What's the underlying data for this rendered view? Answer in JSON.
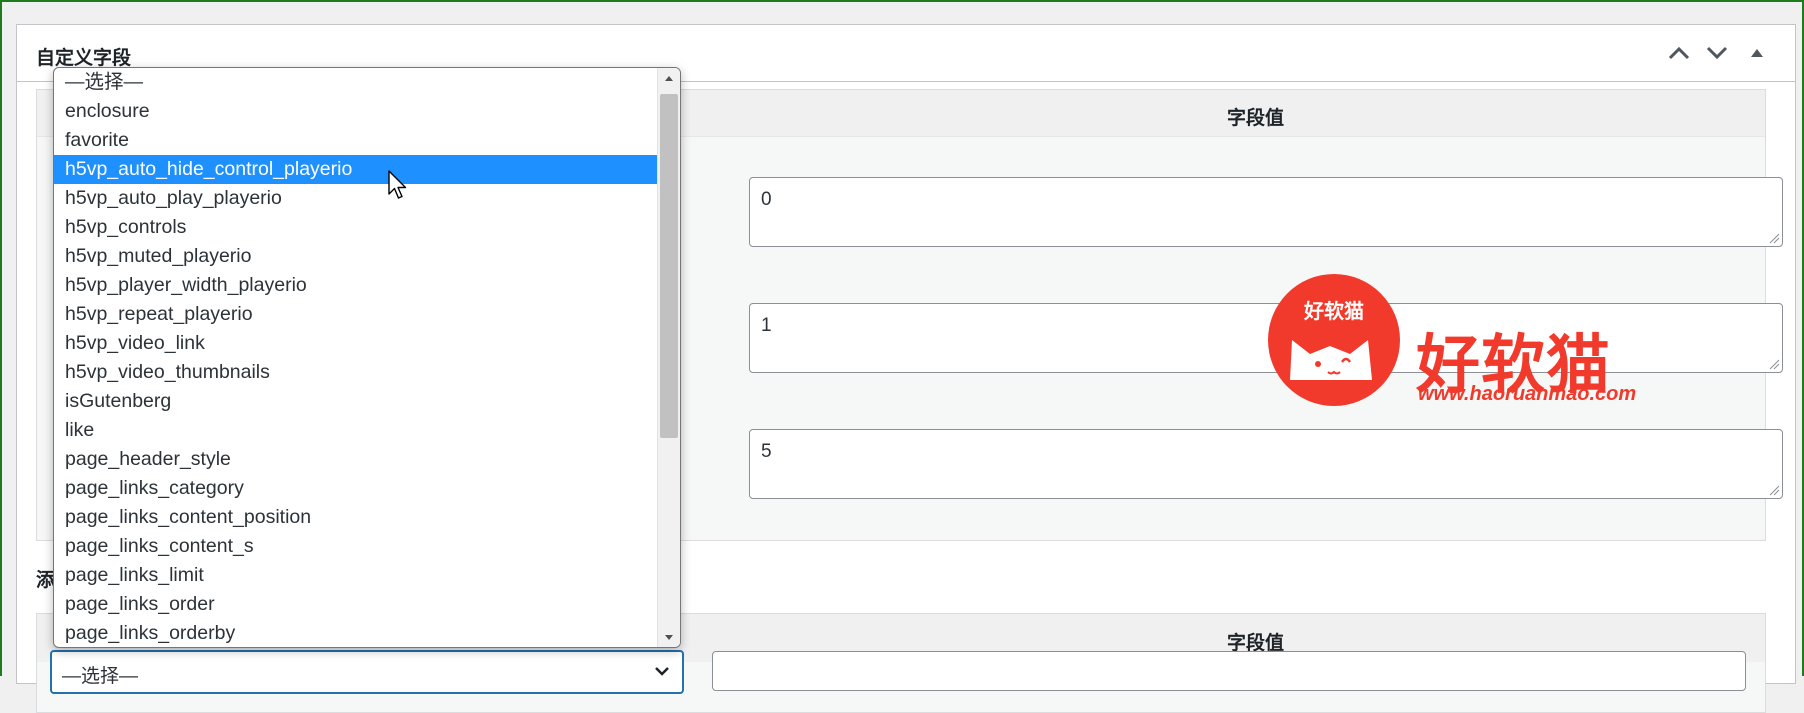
{
  "metabox": {
    "title": "自定义字段",
    "header_icons": [
      "chevron-up-icon",
      "chevron-down-icon",
      "triangle-up-icon"
    ]
  },
  "existing_fields": {
    "value_header": "字段值",
    "values": [
      "0",
      "1",
      "5"
    ]
  },
  "add_new": {
    "title_visible": "添",
    "value_header": "字段值",
    "select_value": "—选择—"
  },
  "dropdown": {
    "options": [
      "—选择—",
      "enclosure",
      "favorite",
      "h5vp_auto_hide_control_playerio",
      "h5vp_auto_play_playerio",
      "h5vp_controls",
      "h5vp_muted_playerio",
      "h5vp_player_width_playerio",
      "h5vp_repeat_playerio",
      "h5vp_video_link",
      "h5vp_video_thumbnails",
      "isGutenberg",
      "like",
      "page_header_style",
      "page_links_category",
      "page_links_content_position",
      "page_links_content_s",
      "page_links_limit",
      "page_links_order",
      "page_links_orderby"
    ],
    "selected_index": 3,
    "selected_value": "h5vp_auto_hide_control_playerio"
  },
  "watermark": {
    "logo_text": "好软猫",
    "brand_text": "好软猫",
    "url": "www.haoruanmao.com"
  },
  "colors": {
    "accent": "#2271b1",
    "selection": "#1e90ff",
    "watermark": "#f23a2c",
    "frame": "#1e7b1e"
  }
}
